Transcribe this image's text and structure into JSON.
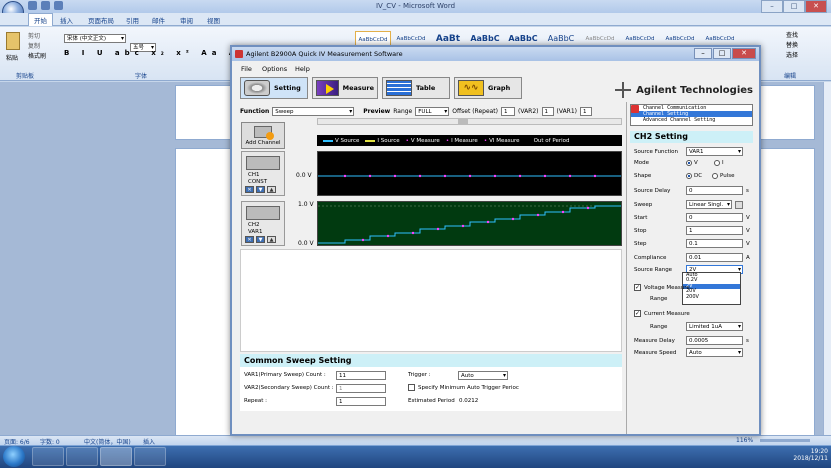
{
  "word": {
    "title": "IV_CV - Microsoft Word",
    "tabs": [
      "开始",
      "插入",
      "页面布局",
      "引用",
      "邮件",
      "审阅",
      "视图"
    ],
    "clipboard": {
      "paste": "粘贴",
      "cut": "剪切",
      "copy": "复制",
      "format_painter": "格式刷",
      "group": "剪贴板"
    },
    "font": {
      "name": "宋体 (中文正文)",
      "size": "五号",
      "group": "字体"
    },
    "styles": [
      "AaBbCcDd",
      "AaBbCcDd",
      "AaBt",
      "AaBbC",
      "AaBbC",
      "AaBbC",
      "AaBbCcDd",
      "AaBbCcDd",
      "AaBbCcDd",
      "AaBbCcDd"
    ],
    "editing": {
      "find": "查找",
      "replace": "替换",
      "select": "选择",
      "group": "编辑"
    },
    "status": {
      "page": "页面: 6/6",
      "words": "字数: 0",
      "lang": "中文(简体，中国)",
      "mode": "插入",
      "zoom": "116%"
    }
  },
  "taskbar": {
    "time": "19:20",
    "date": "2018/12/11"
  },
  "agilent": {
    "title": "Agilent B2900A Quick IV Measurement Software",
    "menu": [
      "File",
      "Options",
      "Help"
    ],
    "toolbar": [
      "Setting",
      "Measure",
      "Table",
      "Graph"
    ],
    "brand": "Agilent Technologies",
    "function_label": "Function",
    "function_value": "Sweep",
    "preview_label": "Preview",
    "range_label": "Range",
    "range_value": "FULL",
    "offset_label": "Offset (Repeat)",
    "offset_value": "1",
    "var2_label": "(VAR2)",
    "var2_value": "1",
    "var1_label": "(VAR1)",
    "var1_value": "1",
    "add_channel": "Add Channel",
    "legend": [
      {
        "label": "V Source",
        "color": "#30c0ff"
      },
      {
        "label": "I Source",
        "color": "#e0e040"
      },
      {
        "label": "V Measure",
        "color": "#ff40ff"
      },
      {
        "label": "I Measure",
        "color": "#ff40ff"
      },
      {
        "label": "VI Measure",
        "color": "#ff40ff"
      },
      {
        "label": "Out of Period",
        "color": ""
      }
    ],
    "ch1": {
      "name": "CH1",
      "mode": "CONST",
      "level": "0.0 V"
    },
    "ch2": {
      "name": "CH2",
      "mode": "VAR1",
      "top": "1.0 V",
      "bottom": "0.0 V"
    },
    "common": {
      "title": "Common Sweep Setting",
      "var1_label": "VAR1(Primary Sweep) Count :",
      "var1_value": "11",
      "var2_label": "VAR2(Secondary Sweep) Count :",
      "var2_value": "1",
      "repeat_label": "Repeat :",
      "repeat_value": "1",
      "trigger_label": "Trigger :",
      "trigger_value": "Auto",
      "specify_label": "Specify Minimum Auto Trigger Perioc",
      "estimated_label": "Estimated Period",
      "estimated_value": "0.0212"
    },
    "right": {
      "list": [
        "Channel Communication",
        "Channel Setting",
        "Advanced Channel Setting"
      ],
      "title": "CH2 Setting",
      "source_function": {
        "label": "Source Function",
        "value": "VAR1"
      },
      "mode": {
        "label": "Mode",
        "opt1": "V",
        "opt2": "I"
      },
      "shape": {
        "label": "Shape",
        "opt1": "DC",
        "opt2": "Pulse"
      },
      "source_delay": {
        "label": "Source Delay",
        "value": "0",
        "unit": "s"
      },
      "sweep": {
        "label": "Sweep",
        "value": "Linear Singl."
      },
      "start": {
        "label": "Start",
        "value": "0",
        "unit": "V"
      },
      "stop": {
        "label": "Stop",
        "value": "1",
        "unit": "V"
      },
      "step": {
        "label": "Step",
        "value": "0.1",
        "unit": "V"
      },
      "compliance": {
        "label": "Compliance",
        "value": "0.01",
        "unit": "A"
      },
      "source_range": {
        "label": "Source Range",
        "value": "2V"
      },
      "range_options": [
        "Auto",
        "0.2V",
        "2V",
        "20V",
        "200V"
      ],
      "voltage_measure": "Voltage Measure",
      "range_label": "Range",
      "current_measure": "Current Measure",
      "current_range": "Limited 1uA",
      "measure_delay": {
        "label": "Measure Delay",
        "value": "0.0005",
        "unit": "s"
      },
      "measure_speed": {
        "label": "Measure Speed",
        "value": "Auto"
      }
    }
  }
}
